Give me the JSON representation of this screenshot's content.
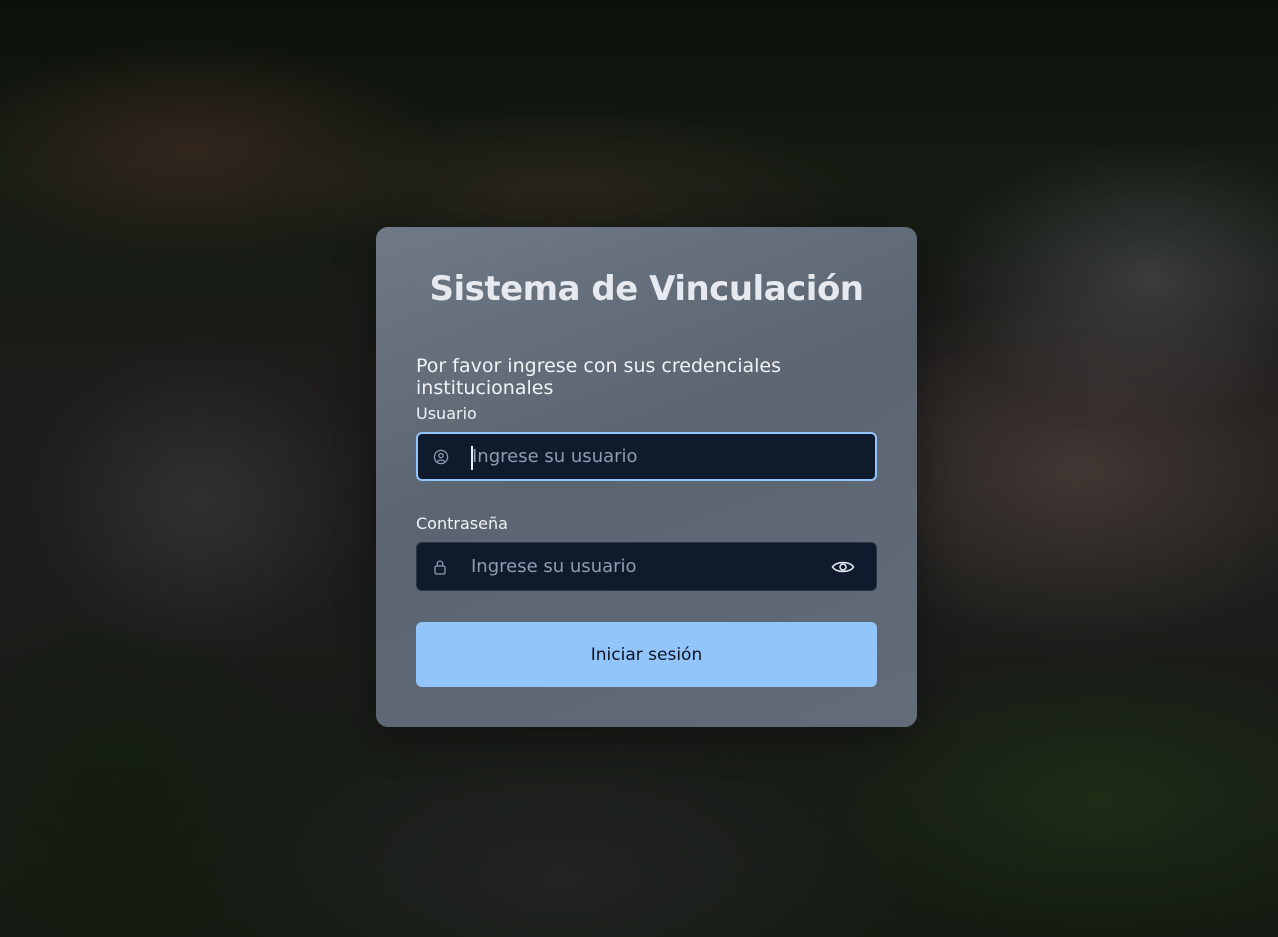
{
  "login": {
    "title": "Sistema de Vinculación",
    "subtitle": "Por favor ingrese con sus credenciales institucionales",
    "username": {
      "label": "Usuario",
      "placeholder": "Ingrese su usuario",
      "value": "",
      "icon": "user-circle-icon"
    },
    "password": {
      "label": "Contraseña",
      "placeholder": "Ingrese su usuario",
      "value": "",
      "icon": "lock-icon",
      "toggle_icon": "eye-icon"
    },
    "submit_label": "Iniciar sesión"
  },
  "colors": {
    "accent": "#93c5fd",
    "input_bg": "#0f1a2c",
    "title_text": "#e6e9ef"
  },
  "background": {
    "icon": "campus-aerial-photo"
  }
}
